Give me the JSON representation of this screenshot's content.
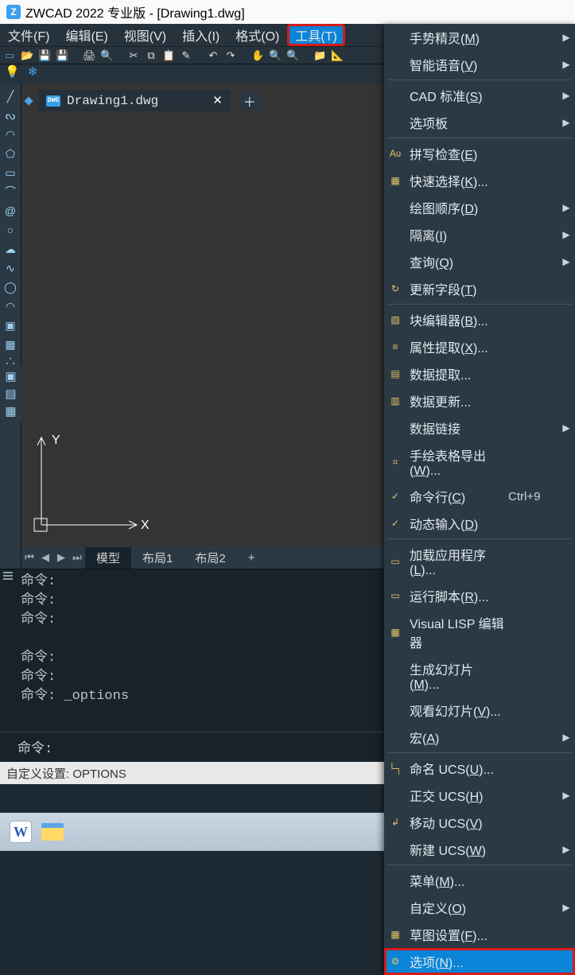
{
  "title": "ZWCAD 2022 专业版 - [Drawing1.dwg]",
  "menubar": {
    "file": "文件(F)",
    "edit": "编辑(E)",
    "view": "视图(V)",
    "insert": "插入(I)",
    "format": "格式(O)",
    "tools": "工具(T)"
  },
  "doc_tab": {
    "name": "Drawing1.dwg"
  },
  "layout_tabs": {
    "model": "模型",
    "layout1": "布局1",
    "layout2": "布局2"
  },
  "axes": {
    "x": "X",
    "y": "Y"
  },
  "cmd_history": {
    "l1": "命令:",
    "l2": "命令:",
    "l3": "命令:",
    "l4": "命令:",
    "l5": "命令:",
    "l6": "命令: _options"
  },
  "cmd_prompt": "命令:",
  "status_text": "自定义设置: OPTIONS",
  "dropdown": [
    {
      "label": "手势精灵",
      "u": "M",
      "sub": true
    },
    {
      "label": "智能语音",
      "u": "V",
      "sub": true
    },
    {
      "sep": true
    },
    {
      "label": "CAD 标准",
      "u": "S",
      "sub": true
    },
    {
      "label": "选项板",
      "sub": true
    },
    {
      "sep": true
    },
    {
      "icon": "Aʋ",
      "label": "拼写检查",
      "u": "E"
    },
    {
      "icon": "▦",
      "label": "快速选择",
      "u": "K",
      "ell": true
    },
    {
      "label": "绘图顺序",
      "u": "D",
      "sub": true
    },
    {
      "label": "隔离",
      "u": "I",
      "sub": true
    },
    {
      "label": "查询",
      "u": "Q",
      "sub": true
    },
    {
      "icon": "↻",
      "label": "更新字段",
      "u": "T"
    },
    {
      "sep": true
    },
    {
      "icon": "▧",
      "label": "块编辑器",
      "u": "B",
      "ell": true
    },
    {
      "icon": "≡",
      "label": "属性提取",
      "u": "X",
      "ell": true
    },
    {
      "icon": "▤",
      "label": "数据提取",
      "ell": true
    },
    {
      "icon": "▥",
      "label": "数据更新",
      "ell": true
    },
    {
      "label": "数据链接",
      "sub": true
    },
    {
      "icon": "⌗",
      "label": "手绘表格导出",
      "u": "W",
      "ell": true
    },
    {
      "icon": "✓",
      "label": "命令行",
      "u": "C",
      "shortcut": "Ctrl+9"
    },
    {
      "icon": "✓",
      "label": "动态输入",
      "u": "D"
    },
    {
      "sep": true
    },
    {
      "icon": "▭",
      "label": "加载应用程序",
      "u": "L",
      "ell": true
    },
    {
      "icon": "▭",
      "label": "运行脚本",
      "u": "R",
      "ell": true
    },
    {
      "icon": "▦",
      "label": "Visual LISP 编辑器"
    },
    {
      "label": "生成幻灯片",
      "u": "M",
      "ell": true
    },
    {
      "label": "观看幻灯片",
      "u": "V",
      "ell": true
    },
    {
      "label": "宏",
      "u": "A",
      "sub": true
    },
    {
      "sep": true
    },
    {
      "icon": "└┐",
      "label": "命名 UCS",
      "u": "U",
      "ell": true
    },
    {
      "label": "正交 UCS",
      "u": "H",
      "sub": true
    },
    {
      "icon": "↲",
      "label": "移动 UCS",
      "u": "V"
    },
    {
      "label": "新建 UCS",
      "u": "W",
      "sub": true
    },
    {
      "sep": true
    },
    {
      "label": "菜单",
      "u": "M",
      "ell": true
    },
    {
      "label": "自定义",
      "u": "O",
      "sub": true
    },
    {
      "icon": "▦",
      "label": "草图设置",
      "u": "F",
      "ell": true
    },
    {
      "icon": "⚙",
      "label": "选项",
      "u": "N",
      "ell": true,
      "highlight": true
    }
  ]
}
